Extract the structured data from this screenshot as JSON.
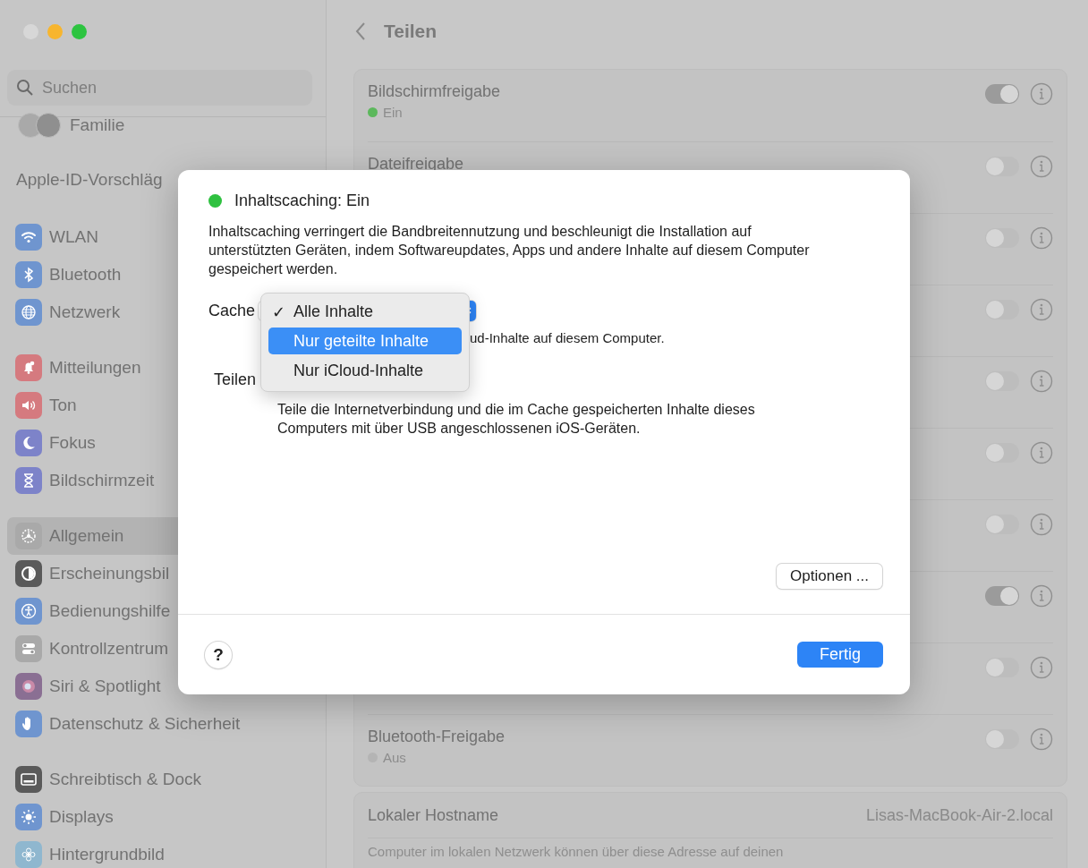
{
  "window": {
    "title": "Teilen"
  },
  "sidebar": {
    "search": {
      "placeholder": "Suchen"
    },
    "family": {
      "label": "Familie"
    },
    "apple_id": {
      "label": "Apple-ID-Vorschläg"
    },
    "groups": [
      {
        "items": [
          {
            "label": "WLAN",
            "color": "#6f95cf",
            "selected": false
          },
          {
            "label": "Bluetooth",
            "color": "#6f95cf",
            "selected": false
          },
          {
            "label": "Netzwerk",
            "color": "#6f95cf",
            "selected": false
          }
        ]
      },
      {
        "items": [
          {
            "label": "Mitteilungen",
            "color": "#d57a7f",
            "selected": false
          },
          {
            "label": "Ton",
            "color": "#d57a7f",
            "selected": false
          },
          {
            "label": "Fokus",
            "color": "#7d83c9",
            "selected": false
          },
          {
            "label": "Bildschirmzeit",
            "color": "#7d83c9",
            "selected": false
          }
        ]
      },
      {
        "items": [
          {
            "label": "Allgemein",
            "color": "#a9a9a9",
            "selected": true
          },
          {
            "label": "Erscheinungsbil",
            "color": "#5a5a5a",
            "selected": false
          },
          {
            "label": "Bedienungshilfe",
            "color": "#6f95cf",
            "selected": false
          },
          {
            "label": "Kontrollzentrum",
            "color": "#a9a9a9",
            "selected": false
          },
          {
            "label": "Siri & Spotlight",
            "color": "#8a6f93",
            "selected": false
          },
          {
            "label": "Datenschutz & Sicherheit",
            "color": "#6f95cf",
            "selected": false
          }
        ]
      },
      {
        "items": [
          {
            "label": "Schreibtisch & Dock",
            "color": "#5a5a5a",
            "selected": false
          },
          {
            "label": "Displays",
            "color": "#6f95cf",
            "selected": false
          },
          {
            "label": "Hintergrundbild",
            "color": "#8fb7cf",
            "selected": false
          }
        ]
      }
    ]
  },
  "services": [
    {
      "label": "Bildschirmfreigabe",
      "status": "Ein",
      "color": "#5cb85c",
      "on": true
    },
    {
      "label": "Dateifreigabe",
      "on": false
    },
    {
      "on": false
    },
    {
      "on": false
    },
    {
      "on": false
    },
    {
      "on": false
    },
    {
      "on": false
    },
    {
      "on": true
    },
    {
      "on": false
    },
    {
      "label": "Bluetooth-Freigabe",
      "status": "Aus",
      "color": "#b4b4b4",
      "on": false
    }
  ],
  "hostname": {
    "label": "Lokaler Hostname",
    "value": "Lisas-MacBook-Air-2.local",
    "description": "Computer im lokalen Netzwerk können über diese Adresse auf deinen"
  },
  "dialog": {
    "title": "Inhaltscaching: Ein",
    "color": "#2fc140",
    "description": "Inhaltscaching verringert die Bandbreitennutzung und beschleunigt die Installation auf unterstützten Geräten, indem Softwareupdates, Apps und andere Inhalte auf diesem Computer gespeichert werden.",
    "cache_label": "Cache",
    "cache_hint": "ud-Inhalte auf diesem Computer.",
    "share_label": "Teilen",
    "share_hint": "Teile die Internetverbindung und die im Cache gespeicherten Inhalte dieses Computers mit über USB angeschlossenen iOS-Geräten.",
    "options_button": "Optionen ...",
    "help_button": "?",
    "done_button": "Fertig",
    "check_mark": "✓",
    "menu": [
      {
        "label": "Alle Inhalte",
        "checked": true,
        "selected": false
      },
      {
        "label": "Nur geteilte Inhalte",
        "checked": false,
        "selected": true
      },
      {
        "label": "Nur iCloud-Inhalte",
        "checked": false,
        "selected": false
      }
    ]
  }
}
